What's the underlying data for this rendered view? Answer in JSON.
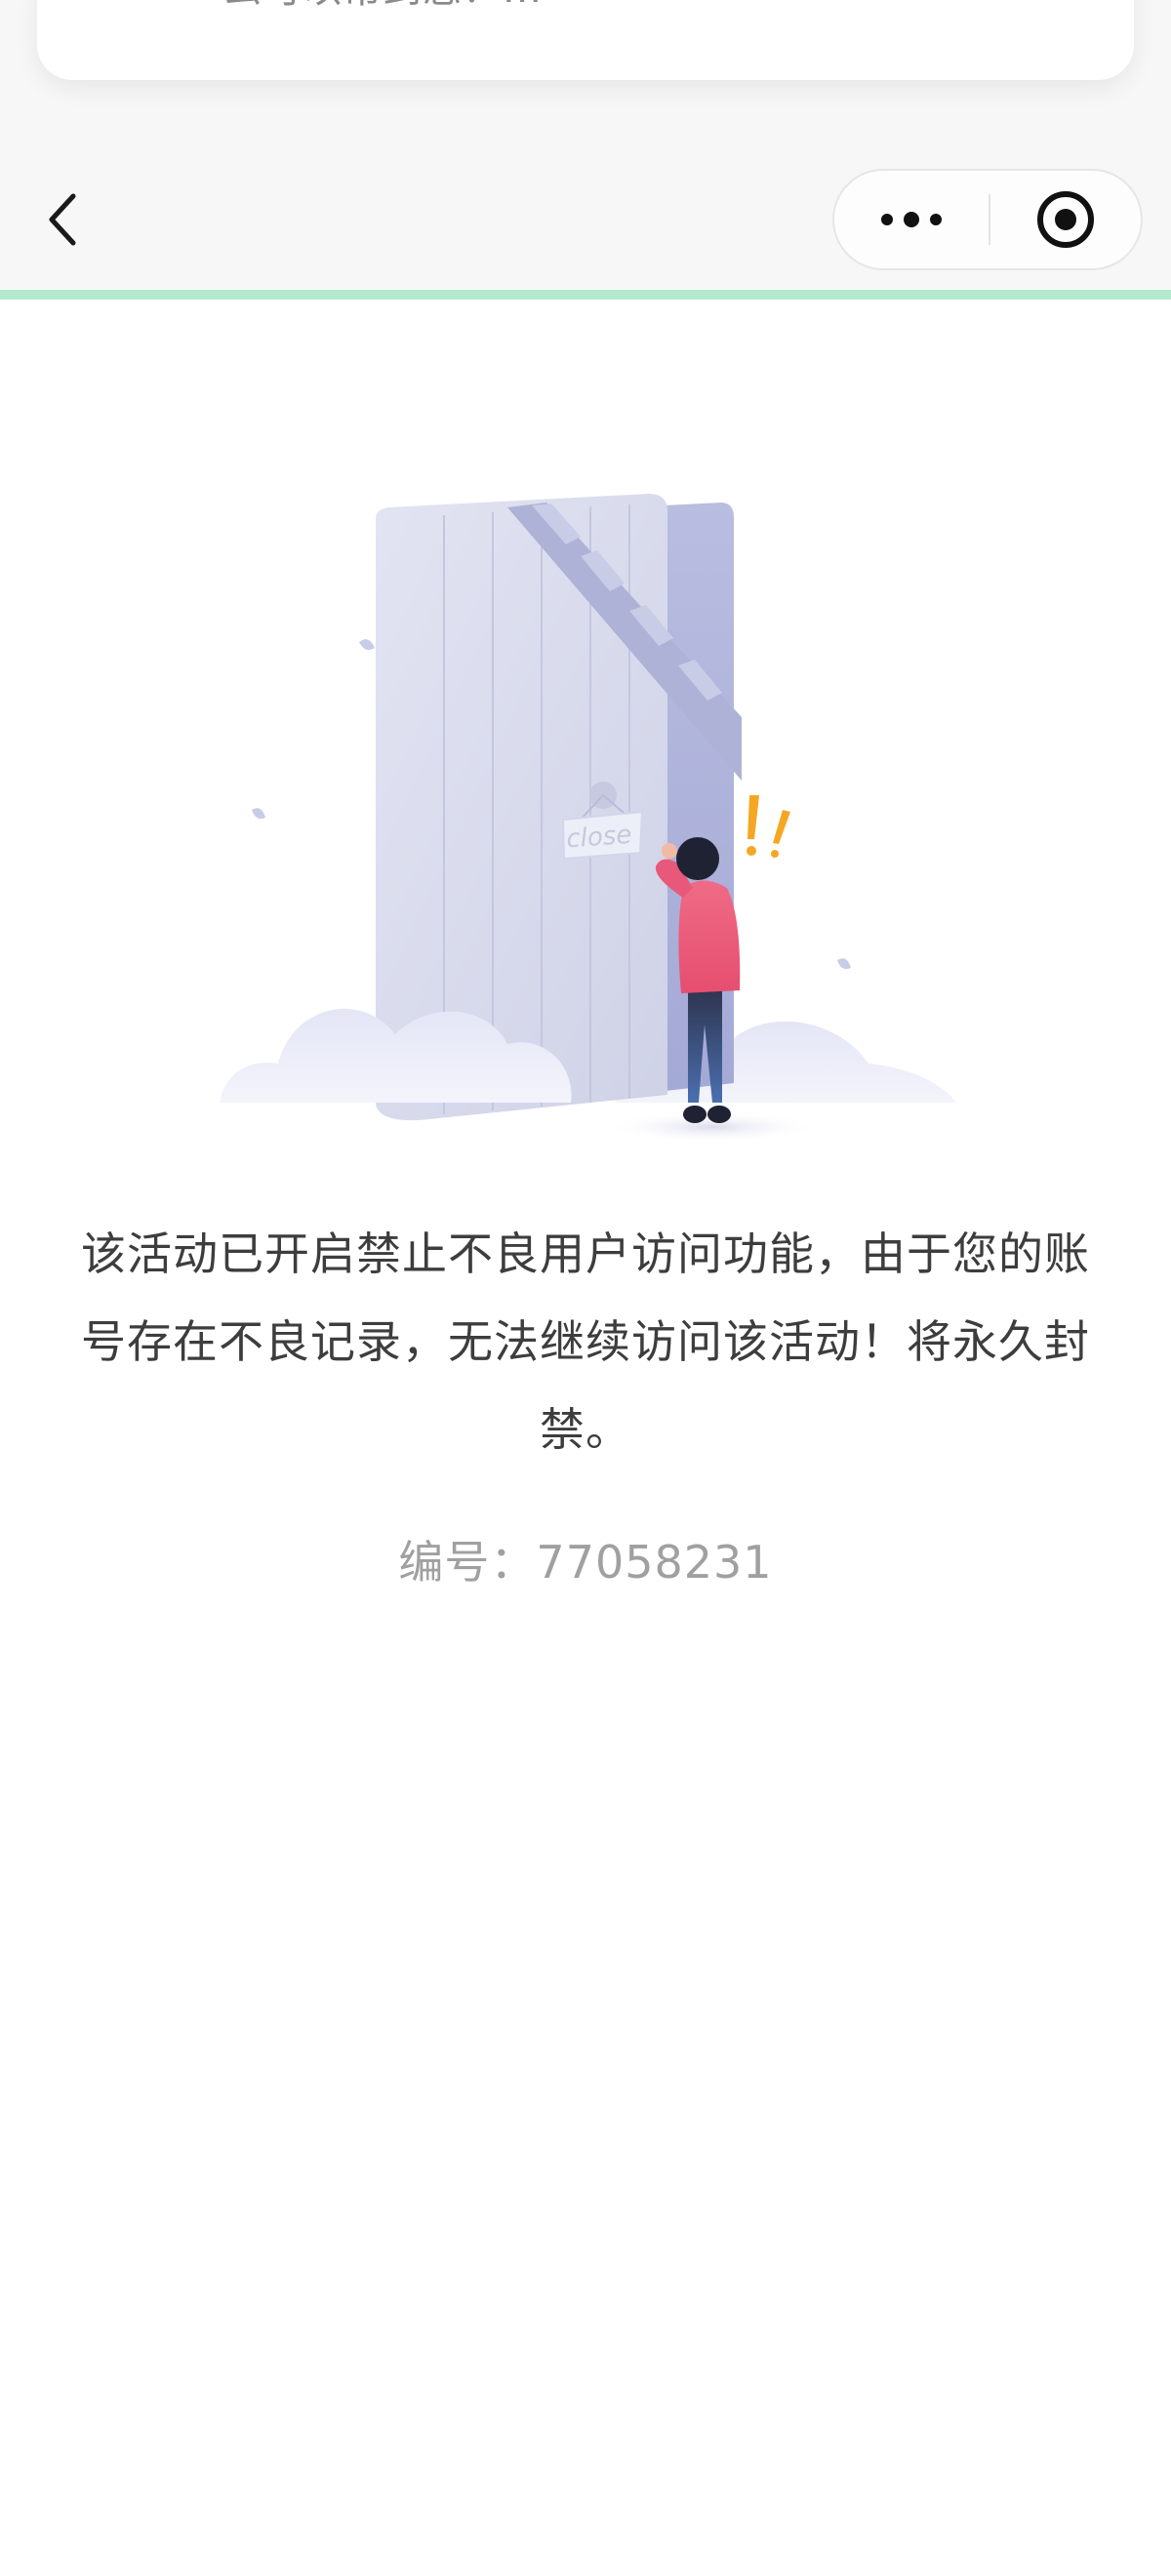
{
  "notification": {
    "text": "么可以帮到您？..."
  },
  "nav": {
    "back_icon": "chevron-left-icon",
    "more_icon": "more-dots-icon",
    "close_icon": "target-close-icon"
  },
  "progress": {
    "fraction": 1.0,
    "color": "#b3e9cd"
  },
  "illustration": {
    "sign_text": "close"
  },
  "message": {
    "text": "该活动已开启禁止不良用户访问功能，由于您的账号存在不良记录，无法继续访问该活动！将永久封禁。"
  },
  "code": {
    "label": "编号：",
    "value": "77058231"
  },
  "colors": {
    "accent_green": "#07c160",
    "person_shirt": "#ef6b86",
    "door": "#d9dbeb",
    "text_primary": "#3d3d3d",
    "text_secondary": "#a0a0a0"
  }
}
